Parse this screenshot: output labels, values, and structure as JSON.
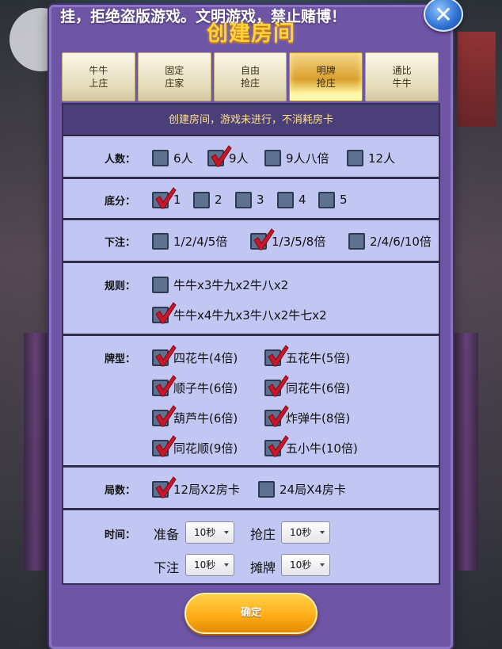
{
  "header": {
    "warning": "挂，拒绝盗版游戏。文明游戏，禁止赌博！",
    "title": "创建房间",
    "close_icon": "close-icon"
  },
  "tabs": [
    {
      "line1": "牛牛",
      "line2": "上庄",
      "active": false
    },
    {
      "line1": "固定",
      "line2": "庄家",
      "active": false
    },
    {
      "line1": "自由",
      "line2": "抢庄",
      "active": false
    },
    {
      "line1": "明牌",
      "line2": "抢庄",
      "active": true
    },
    {
      "line1": "通比",
      "line2": "牛牛",
      "active": false
    }
  ],
  "notice": "创建房间，游戏未进行，不消耗房卡",
  "players": {
    "label": "人数：",
    "options": [
      {
        "text": "6人",
        "checked": false
      },
      {
        "text": "9人",
        "checked": true
      },
      {
        "text": "9人八倍",
        "checked": false
      },
      {
        "text": "12人",
        "checked": false
      }
    ]
  },
  "base_score": {
    "label": "底分：",
    "options": [
      {
        "text": "1",
        "checked": true
      },
      {
        "text": "2",
        "checked": false
      },
      {
        "text": "3",
        "checked": false
      },
      {
        "text": "4",
        "checked": false
      },
      {
        "text": "5",
        "checked": false
      }
    ]
  },
  "bet": {
    "label": "下注：",
    "options": [
      {
        "text": "1/2/4/5倍",
        "checked": false
      },
      {
        "text": "1/3/5/8倍",
        "checked": true
      },
      {
        "text": "2/4/6/10倍",
        "checked": false
      }
    ]
  },
  "rules": {
    "label": "规则：",
    "options": [
      {
        "text": "牛牛x3牛九x2牛八x2",
        "checked": false
      },
      {
        "text": "牛牛x4牛九x3牛八x2牛七x2",
        "checked": true
      }
    ]
  },
  "card_types": {
    "label": "牌型：",
    "options": [
      {
        "text": "四花牛(4倍)",
        "checked": true
      },
      {
        "text": "五花牛(5倍)",
        "checked": true
      },
      {
        "text": "顺子牛(6倍)",
        "checked": true
      },
      {
        "text": "同花牛(6倍)",
        "checked": true
      },
      {
        "text": "葫芦牛(6倍)",
        "checked": true
      },
      {
        "text": "炸弹牛(8倍)",
        "checked": true
      },
      {
        "text": "同花顺(9倍)",
        "checked": true
      },
      {
        "text": "五小牛(10倍)",
        "checked": true
      }
    ]
  },
  "rounds": {
    "label": "局数：",
    "options": [
      {
        "text": "12局X2房卡",
        "checked": true
      },
      {
        "text": "24局X4房卡",
        "checked": false
      }
    ]
  },
  "timing": {
    "label": "时间：",
    "ready_label": "准备",
    "ready_value": "10秒",
    "grab_label": "抢庄",
    "grab_value": "10秒",
    "bet_label": "下注",
    "bet_value": "10秒",
    "show_label": "摊牌",
    "show_value": "10秒"
  },
  "confirm_label": "确定"
}
